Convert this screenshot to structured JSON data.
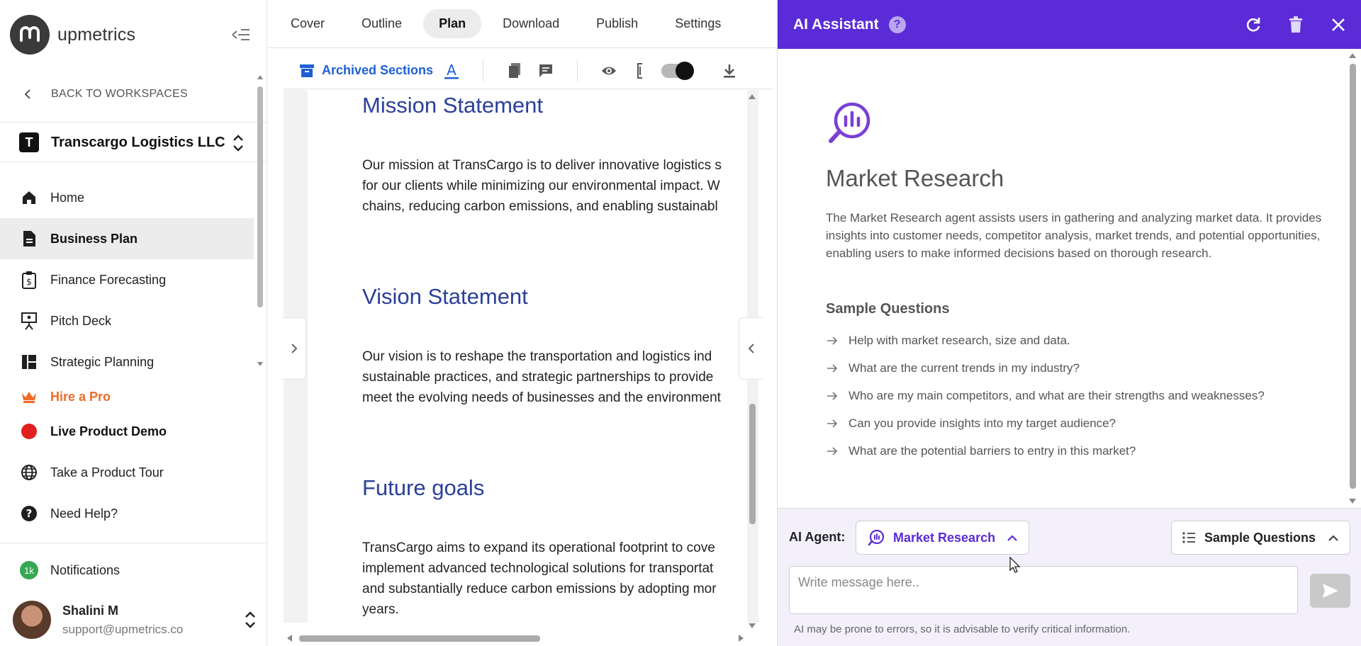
{
  "sidebar": {
    "logo_text": "upmetrics",
    "back_label": "BACK TO WORKSPACES",
    "workspace": {
      "initial": "T",
      "name": "Transcargo Logistics LLC"
    },
    "items": [
      {
        "label": "Home",
        "icon": "home-icon"
      },
      {
        "label": "Business Plan",
        "icon": "document-icon",
        "active": true
      },
      {
        "label": "Finance Forecasting",
        "icon": "finance-clipboard-icon"
      },
      {
        "label": "Pitch Deck",
        "icon": "presentation-icon"
      },
      {
        "label": "Strategic Planning",
        "icon": "dashboard-icon"
      },
      {
        "label": "Hire a Pro",
        "icon": "crown-icon"
      },
      {
        "label": "Live Product Demo",
        "icon": "live-dot-icon"
      },
      {
        "label": "Take a Product Tour",
        "icon": "globe-icon"
      },
      {
        "label": "Need Help?",
        "icon": "help-icon"
      }
    ],
    "notifications": {
      "badge": "1k",
      "label": "Notifications"
    },
    "user": {
      "name": "Shalini M",
      "email": "support@upmetrics.co"
    }
  },
  "editor": {
    "tabs": [
      "Cover",
      "Outline",
      "Plan",
      "Download",
      "Publish",
      "Settings"
    ],
    "active_tab": "Plan",
    "toolbar": {
      "archived_label": "Archived Sections"
    },
    "sections": [
      {
        "title": "Mission Statement",
        "lines": [
          "Our mission at TransCargo is to deliver innovative logistics s",
          "for our clients while minimizing our environmental impact. W",
          "chains, reducing carbon emissions, and enabling sustainabl"
        ]
      },
      {
        "title": "Vision Statement",
        "lines": [
          "Our vision is to reshape the transportation and logistics ind",
          "sustainable practices, and strategic partnerships to provide",
          "meet the evolving needs of businesses and the environment"
        ]
      },
      {
        "title": "Future goals",
        "lines": [
          "TransCargo aims to expand its operational footprint to cove",
          "implement advanced technological solutions for transportat",
          "and substantially reduce carbon emissions by adopting mor",
          "years."
        ]
      }
    ]
  },
  "ai": {
    "title": "AI Assistant",
    "agent_name": "Market Research",
    "description": "The Market Research agent assists users in gathering and analyzing market data. It provides insights into customer needs, competitor analysis, market trends, and potential opportunities, enabling users to make informed decisions based on thorough research.",
    "sample_title": "Sample Questions",
    "questions": [
      "Help with market research, size and data.",
      "What are the current trends in my industry?",
      "Who are my main competitors, and what are their strengths and weaknesses?",
      "Can you provide insights into my target audience?",
      "What are the potential barriers to entry in this market?"
    ],
    "footer": {
      "agent_label": "AI Agent:",
      "agent_selected": "Market Research",
      "sample_button": "Sample Questions",
      "placeholder": "Write message here..",
      "disclaimer": "AI may be prone to errors, so it is advisable to verify critical information."
    }
  },
  "colors": {
    "accent": "#5a2bd6",
    "link_blue": "#1f5fd6",
    "heading_blue": "#2a3f9a",
    "hire_orange": "#f06a2a",
    "live_red": "#e0201f"
  }
}
